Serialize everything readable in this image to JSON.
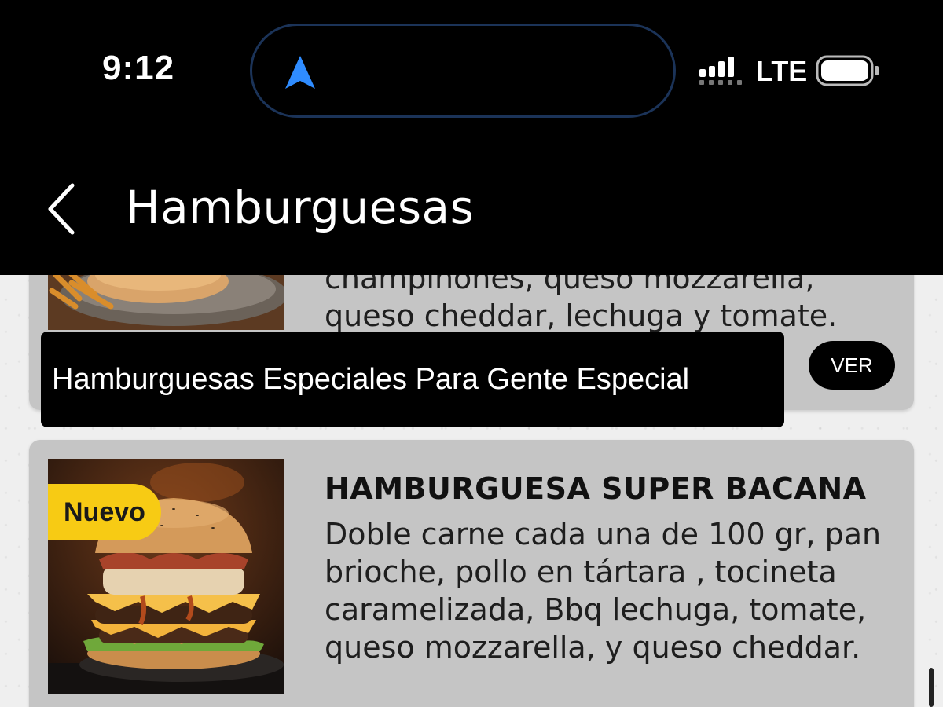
{
  "status_bar": {
    "time": "9:12",
    "network": "LTE",
    "icons": [
      "navigation-arrow-icon",
      "signal-icon",
      "battery-icon"
    ]
  },
  "app_bar": {
    "back_icon": "chevron-left-icon",
    "title": "Hamburguesas"
  },
  "products": [
    {
      "description_partial": "champiñones, queso mozzarella, queso cheddar, lechuga y tomate.",
      "button_label": "VER"
    },
    {
      "badge": "Nuevo",
      "name": "HAMBURGUESA SUPER BACANA",
      "description": "Doble carne cada una de 100 gr, pan brioche, pollo en tártara , tocineta caramelizada, Bbq lechuga, tomate, queso mozzarella, y queso cheddar."
    }
  ],
  "toast": {
    "message": "Hamburguesas Especiales Para Gente Especial"
  },
  "colors": {
    "badge": "#f7cb14",
    "card_bg": "#c5c5c5",
    "header_bg": "#000000",
    "island_border": "#1b3358",
    "nav_arrow": "#2f8cff"
  }
}
